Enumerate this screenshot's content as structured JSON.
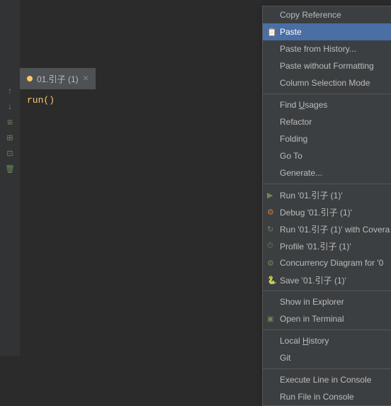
{
  "editor": {
    "background": "#2b2b2b",
    "tab_name": "01.引子 (1)",
    "code_line": "run()"
  },
  "context_menu": {
    "items": [
      {
        "id": "copy-reference",
        "label": "Copy Reference",
        "icon": "",
        "highlighted": false,
        "separator_after": false
      },
      {
        "id": "paste",
        "label": "Paste",
        "icon": "📋",
        "highlighted": true,
        "separator_after": false
      },
      {
        "id": "paste-from-history",
        "label": "Paste from History...",
        "icon": "",
        "highlighted": false,
        "separator_after": false
      },
      {
        "id": "paste-without-formatting",
        "label": "Paste without Formatting",
        "icon": "",
        "highlighted": false,
        "separator_after": false
      },
      {
        "id": "column-selection-mode",
        "label": "Column Selection Mode",
        "icon": "",
        "highlighted": false,
        "separator_after": true
      },
      {
        "id": "find-usages",
        "label": "Find Usages",
        "icon": "",
        "highlighted": false,
        "separator_after": false
      },
      {
        "id": "refactor",
        "label": "Refactor",
        "icon": "",
        "highlighted": false,
        "separator_after": false
      },
      {
        "id": "folding",
        "label": "Folding",
        "icon": "",
        "highlighted": false,
        "separator_after": false
      },
      {
        "id": "go-to",
        "label": "Go To",
        "icon": "",
        "highlighted": false,
        "separator_after": false
      },
      {
        "id": "generate",
        "label": "Generate...",
        "icon": "",
        "highlighted": false,
        "separator_after": true
      },
      {
        "id": "run",
        "label": "Run '01.引子 (1)'",
        "icon": "▶",
        "highlighted": false,
        "separator_after": false
      },
      {
        "id": "debug",
        "label": "Debug '01.引子 (1)'",
        "icon": "🐛",
        "highlighted": false,
        "separator_after": false
      },
      {
        "id": "run-coverage",
        "label": "Run '01.引子 (1)' with Covera",
        "icon": "↻",
        "highlighted": false,
        "separator_after": false
      },
      {
        "id": "profile",
        "label": "Profile '01.引子 (1)'",
        "icon": "⏱",
        "highlighted": false,
        "separator_after": false
      },
      {
        "id": "concurrency",
        "label": "Concurrency Diagram for '0",
        "icon": "⚙",
        "highlighted": false,
        "separator_after": false
      },
      {
        "id": "save",
        "label": "Save '01.引子 (1)'",
        "icon": "🐍",
        "highlighted": false,
        "separator_after": true
      },
      {
        "id": "show-explorer",
        "label": "Show in Explorer",
        "icon": "",
        "highlighted": false,
        "separator_after": false
      },
      {
        "id": "open-terminal",
        "label": "Open in Terminal",
        "icon": "▣",
        "highlighted": false,
        "separator_after": true
      },
      {
        "id": "local-history",
        "label": "Local History",
        "icon": "",
        "highlighted": false,
        "separator_after": false
      },
      {
        "id": "git",
        "label": "Git",
        "icon": "",
        "highlighted": false,
        "separator_after": true
      },
      {
        "id": "execute-line",
        "label": "Execute Line in Console",
        "icon": "",
        "highlighted": false,
        "separator_after": false
      },
      {
        "id": "run-file",
        "label": "Run File in Console",
        "icon": "",
        "highlighted": false,
        "separator_after": false
      }
    ]
  },
  "gutter_icons": [
    "↑",
    "↓",
    "≡",
    "⊞",
    "⊡",
    "🗑"
  ]
}
